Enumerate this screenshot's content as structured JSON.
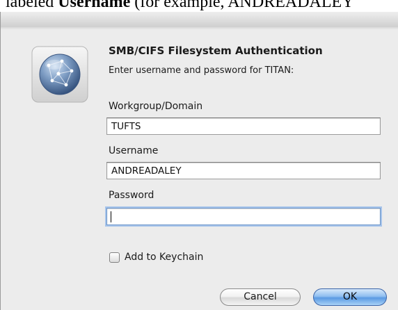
{
  "caption": {
    "prefix": "labeled ",
    "bold": "Username",
    "suffix": " (for example, ANDREADALEY"
  },
  "dialog": {
    "heading": "SMB/CIFS Filesystem Authentication",
    "subheading": "Enter username and password for TITAN:",
    "icon": "network-globe-icon",
    "fields": {
      "workgroup": {
        "label": "Workgroup/Domain",
        "value": "TUFTS"
      },
      "username": {
        "label": "Username",
        "value": "ANDREADALEY"
      },
      "password": {
        "label": "Password",
        "value": ""
      }
    },
    "keychain": {
      "label": "Add to Keychain",
      "checked": false
    },
    "buttons": {
      "cancel": "Cancel",
      "ok": "OK"
    },
    "colors": {
      "accent": "#5b9ae3",
      "focus_ring": "#a7c4ea",
      "window_bg": "#ececec"
    }
  }
}
